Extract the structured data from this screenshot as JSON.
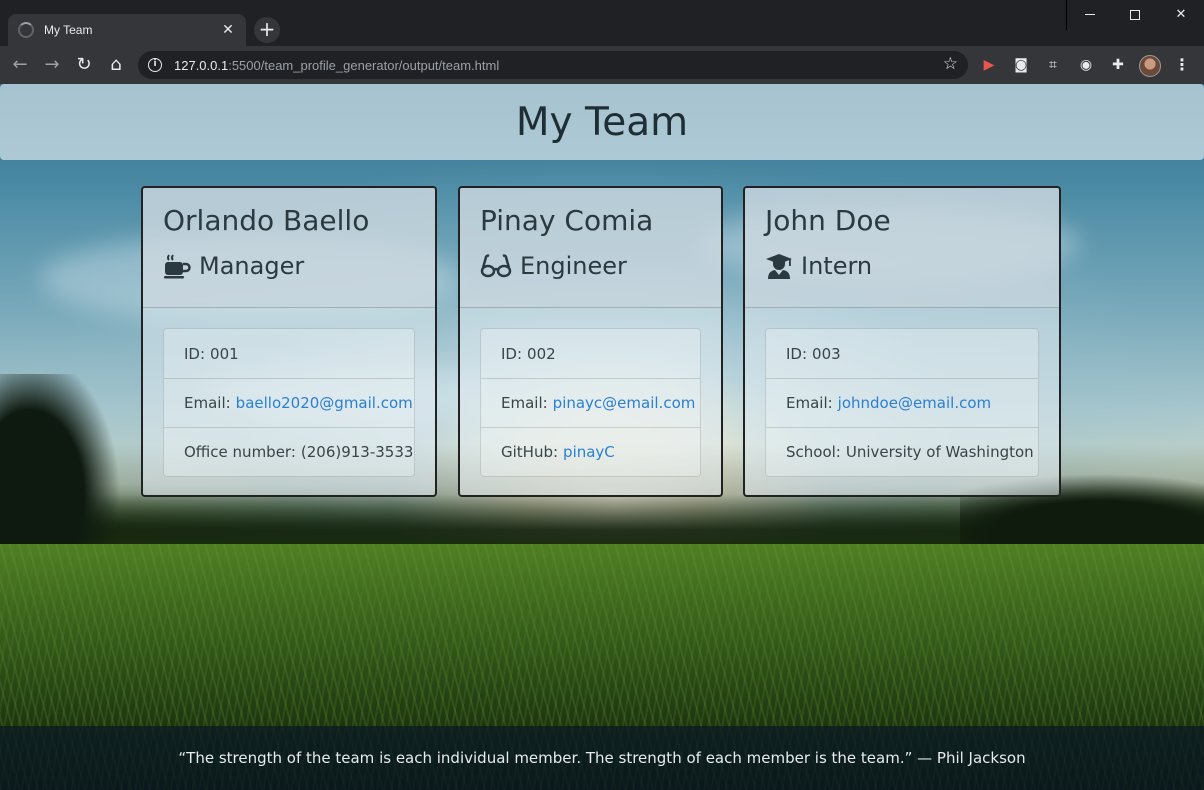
{
  "browser": {
    "tab_title": "My Team",
    "url_host": "127.0.0.1",
    "url_path": ":5500/team_profile_generator/output/team.html"
  },
  "page": {
    "heading": "My Team",
    "members": [
      {
        "name": "Orlando Baello",
        "role": "Manager",
        "role_icon": "mug-icon",
        "id_label": "ID:",
        "id": "001",
        "email_label": "Email:",
        "email": "baello2020@gmail.com",
        "extra_label": "Office number:",
        "extra_value": "(206)913-3533",
        "extra_is_link": false
      },
      {
        "name": "Pinay Comia",
        "role": "Engineer",
        "role_icon": "glasses-icon",
        "id_label": "ID:",
        "id": "002",
        "email_label": "Email:",
        "email": "pinayc@email.com",
        "extra_label": "GitHub:",
        "extra_value": "pinayC",
        "extra_is_link": true
      },
      {
        "name": "John Doe",
        "role": "Intern",
        "role_icon": "graduate-icon",
        "id_label": "ID:",
        "id": "003",
        "email_label": "Email:",
        "email": "johndoe@email.com",
        "extra_label": "School:",
        "extra_value": "University of Washington",
        "extra_is_link": false
      }
    ],
    "footer_quote": "“The strength of the team is each individual member. The strength of each member is the team.” — Phil Jackson"
  },
  "colors": {
    "link": "#2a7fd3",
    "card_border": "#222222",
    "heading_text": "#1f2e35"
  }
}
